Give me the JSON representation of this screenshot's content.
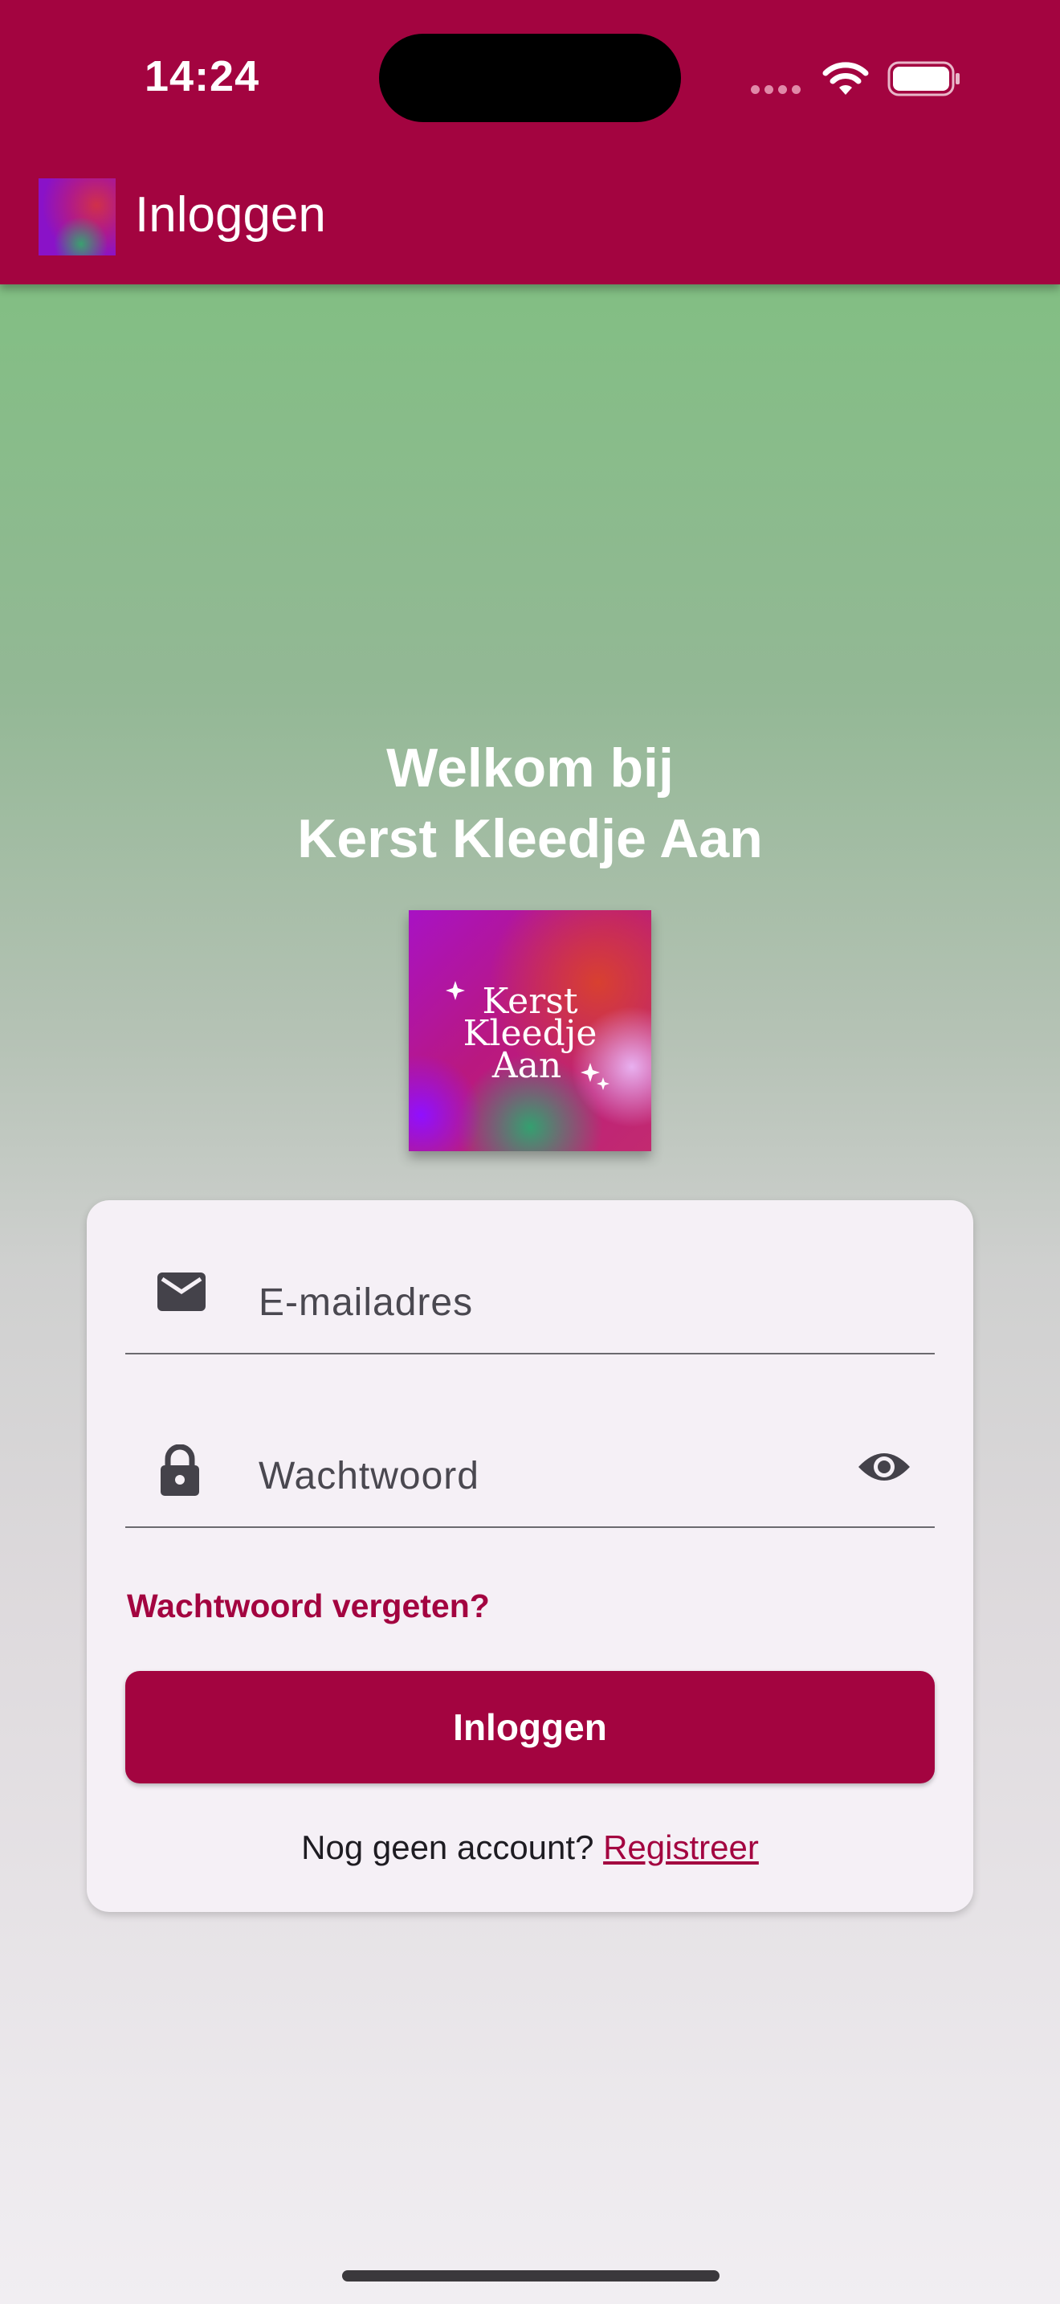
{
  "status_bar": {
    "time": "14:24"
  },
  "app_bar": {
    "title": "Inloggen",
    "icon": "app-logo-icon"
  },
  "main": {
    "welcome_line1": "Welkom bij",
    "welcome_line2": "Kerst Kleedje Aan",
    "logo_text": "Kerst Kleedje Aan"
  },
  "form": {
    "email_label": "E-mailadres",
    "password_label": "Wachtwoord",
    "forgot_password": "Wachtwoord vergeten?",
    "login_button": "Inloggen",
    "register_prompt": "Nog geen account?",
    "register_link": "Registreer"
  },
  "colors": {
    "primary": "#a30440",
    "card_background": "#f5f0f6",
    "gradient_top": "#7ac07c",
    "gradient_bottom": "#f1eef2"
  }
}
